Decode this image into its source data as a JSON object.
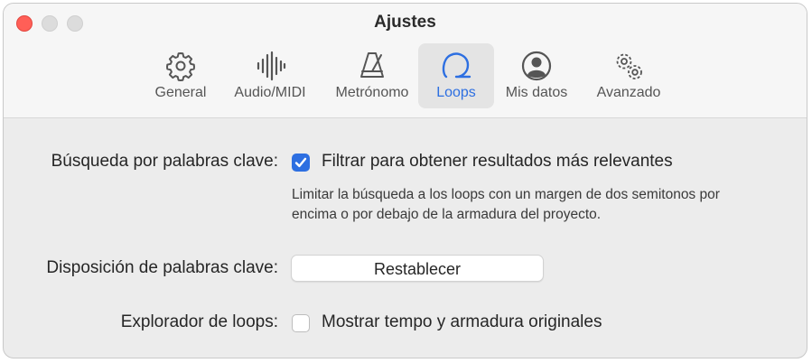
{
  "window": {
    "title": "Ajustes"
  },
  "toolbar": {
    "tabs": [
      {
        "label": "General",
        "icon": "gear-icon"
      },
      {
        "label": "Audio/MIDI",
        "icon": "waveform-icon"
      },
      {
        "label": "Metrónomo",
        "icon": "metronome-icon"
      },
      {
        "label": "Loops",
        "icon": "loop-icon",
        "active": true
      },
      {
        "label": "Mis datos",
        "icon": "person-circle-icon"
      },
      {
        "label": "Avanzado",
        "icon": "gears-icon"
      }
    ]
  },
  "settings": {
    "keyword_search": {
      "label": "Búsqueda por palabras clave:",
      "checkbox_label": "Filtrar para obtener resultados más relevantes",
      "checked": true,
      "help_line1": "Limitar la búsqueda a los loops con un margen de dos semitonos por",
      "help_line2": "encima o por debajo de la armadura del proyecto."
    },
    "keyword_layout": {
      "label": "Disposición de palabras clave:",
      "button_label": "Restablecer"
    },
    "loop_browser": {
      "label": "Explorador de loops:",
      "checkbox_label": "Mostrar tempo y armadura originales",
      "checked": false
    }
  },
  "colors": {
    "accent": "#2d6fe1",
    "close": "#ff5f57"
  }
}
